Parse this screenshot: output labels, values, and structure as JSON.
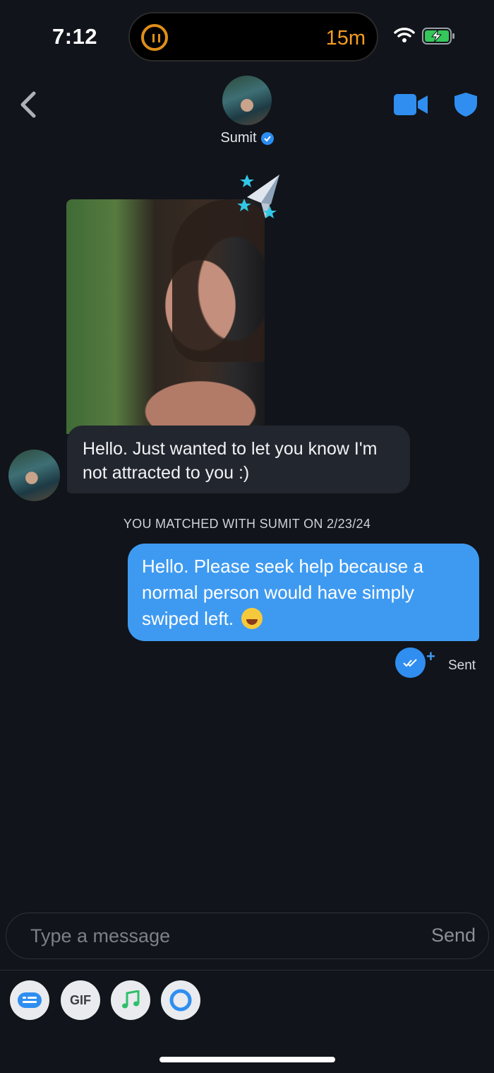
{
  "status_bar": {
    "time": "7:12",
    "activity_timer": "15m",
    "activity_icon": "pause-icon",
    "wifi_icon": "wifi-icon",
    "battery_icon": "battery-charging-icon"
  },
  "header": {
    "back_icon": "chevron-left-icon",
    "name": "Sumit",
    "verified_icon": "verified-check-icon",
    "video_icon": "video-call-icon",
    "safety_icon": "shield-icon"
  },
  "messages": {
    "incoming_photo_decoration": "paper-plane-stars-icon",
    "incoming_text": "Hello. Just wanted to let you know I'm not attracted to you :)",
    "match_notice": "YOU MATCHED WITH SUMIT ON 2/23/24",
    "outgoing_text": "Hello. Please seek help because a normal person would have simply swiped left.",
    "outgoing_emoji": "grinning-squinting-face-emoji",
    "read_icon": "double-check-icon",
    "read_plus": "+",
    "status": "Sent"
  },
  "composer": {
    "placeholder": "Type a message",
    "send_label": "Send"
  },
  "toolbar": {
    "sticker_icon": "sticker-icon",
    "gif_label": "GIF",
    "music_icon": "music-note-icon",
    "loop_icon": "loop-circle-icon"
  },
  "colors": {
    "background": "#11141a",
    "outgoing_bubble": "#3e9af1",
    "incoming_bubble": "#22262e",
    "accent_blue": "#2f8ef0",
    "activity_orange": "#f39c21"
  }
}
